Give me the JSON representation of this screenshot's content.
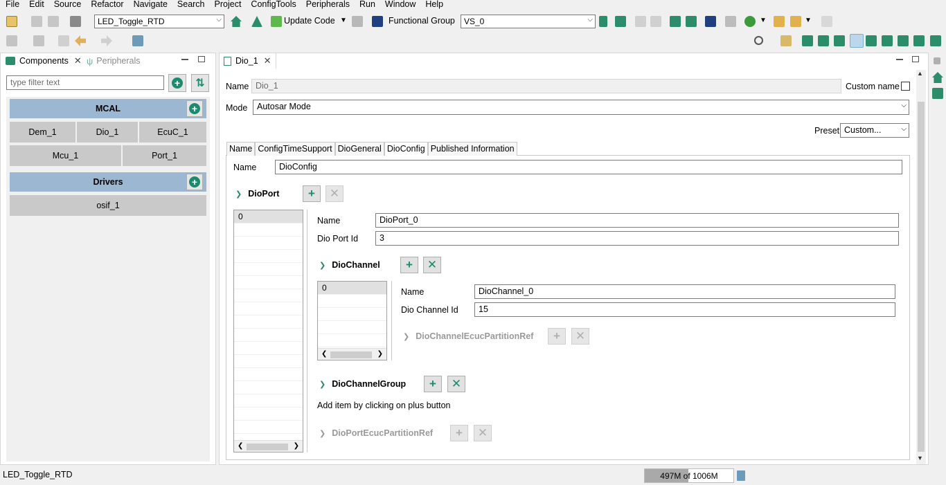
{
  "menu": [
    "File",
    "Edit",
    "Source",
    "Refactor",
    "Navigate",
    "Search",
    "Project",
    "ConfigTools",
    "Peripherals",
    "Run",
    "Window",
    "Help"
  ],
  "toolbar": {
    "project_combo": "LED_Toggle_RTD",
    "update_code_label": "Update Code",
    "functional_group_label": "Functional Group",
    "functional_group_value": "VS_0"
  },
  "left_panel": {
    "tab_components": "Components",
    "tab_peripherals": "Peripherals",
    "filter_placeholder": "type filter text",
    "categories": [
      {
        "title": "MCAL",
        "items": [
          "Dem_1",
          "Dio_1",
          "EcuC_1",
          "Mcu_1",
          "Port_1"
        ]
      },
      {
        "title": "Drivers",
        "items": [
          "osif_1"
        ]
      }
    ]
  },
  "editor": {
    "tab_title": "Dio_1",
    "name_label": "Name",
    "name_value": "Dio_1",
    "custom_name_label": "Custom name",
    "mode_label": "Mode",
    "mode_value": "Autosar Mode",
    "preset_label": "Preset",
    "preset_value": "Custom...",
    "sub_tabs": [
      "Name",
      "ConfigTimeSupport",
      "DioGeneral",
      "DioConfig",
      "Published Information"
    ],
    "config_name_label": "Name",
    "config_name_value": "DioConfig",
    "dio_port": {
      "title": "DioPort",
      "list": [
        "0"
      ],
      "name_label": "Name",
      "name_value": "DioPort_0",
      "id_label": "Dio Port Id",
      "id_value": "3"
    },
    "dio_channel": {
      "title": "DioChannel",
      "list": [
        "0"
      ],
      "name_label": "Name",
      "name_value": "DioChannel_0",
      "id_label": "Dio Channel Id",
      "id_value": "15",
      "partition_ref": "DioChannelEcucPartitionRef"
    },
    "dio_channel_group": {
      "title": "DioChannelGroup",
      "hint": "Add item by clicking on plus button"
    },
    "port_partition_ref": "DioPortEcucPartitionRef"
  },
  "status": {
    "project": "LED_Toggle_RTD",
    "memory": "497M of 1006M",
    "memory_used_fraction": 0.494
  },
  "colors": {
    "accent_green": "#1c8a6e",
    "category_blue": "#9cb7d1",
    "component_gray": "#c9c9c9"
  }
}
